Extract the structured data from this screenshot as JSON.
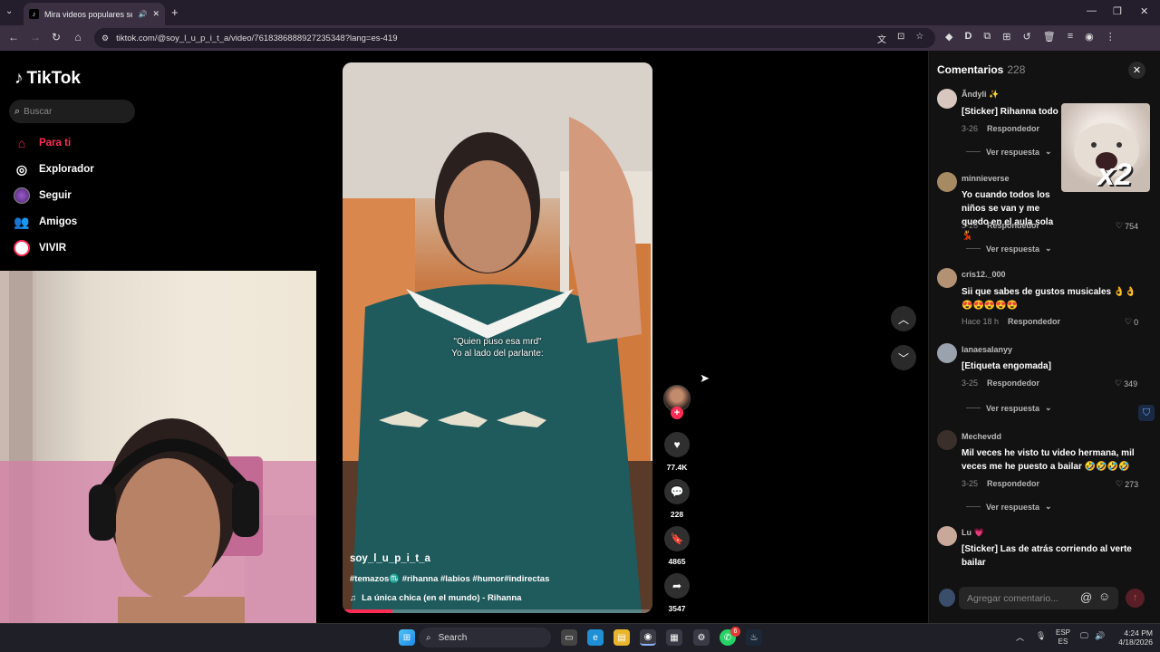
{
  "browser": {
    "tab_title": "Mira videos populares selec",
    "url": "tiktok.com/@soy_l_u_p_i_t_a/video/7618386888927235348?lang=es-419",
    "new_tab": "+",
    "minimize": "—",
    "restore": "❐",
    "close": "✕",
    "profile_letter": "D"
  },
  "tiktok": {
    "logo": "TikTok",
    "search_placeholder": "Buscar",
    "nav": [
      {
        "label": "Para ti",
        "active": true
      },
      {
        "label": "Explorador"
      },
      {
        "label": "Seguir"
      },
      {
        "label": "Amigos"
      },
      {
        "label": "VIVIR"
      }
    ]
  },
  "video": {
    "caption_line1": "\"Quien puso esa mrd\"",
    "caption_line2": "Yo al lado del parlante:",
    "username": "soy_l_u_p_i_t_a",
    "tags": "#temazos♏ #rihanna #labios #humor#indirectas",
    "music": "La única chica (en el mundo) - Rihanna",
    "progress": 0.16
  },
  "actions": {
    "likes": "77.4K",
    "comments": "228",
    "saves": "4865",
    "shares": "3547"
  },
  "comments_panel": {
    "title": "Comentarios",
    "count": "228",
    "sticker_text": "x2",
    "input_placeholder": "Agregar comentario...",
    "items": [
      {
        "user": "Ãndyli ✨",
        "text": "[Sticker] Rihanna todo c",
        "date": "3-26",
        "reply": "Respondedor",
        "likes": "",
        "view_replies": "Ver respuesta"
      },
      {
        "user": "minnieverse",
        "text": "Yo cuando todos los niños se van y me quedo en el aula sola 💃",
        "date": "3-26",
        "reply": "Respondedor",
        "likes": "754",
        "view_replies": "Ver respuesta"
      },
      {
        "user": "cris12._000",
        "text": "Sii que sabes de gustos musicales 👌👌 😍😍😍😍😍",
        "date": "Hace 18 h",
        "reply": "Respondedor",
        "likes": "0",
        "view_replies": ""
      },
      {
        "user": "lanaesalanyy",
        "text": "[Etiqueta engomada]",
        "date": "3-25",
        "reply": "Respondedor",
        "likes": "349",
        "view_replies": "Ver respuesta"
      },
      {
        "user": "Mechevdd",
        "text": "Mil veces he visto tu video hermana, mil veces me he puesto a bailar 🤣🤣🤣🤣",
        "date": "3-25",
        "reply": "Respondedor",
        "likes": "273",
        "view_replies": "Ver respuesta"
      },
      {
        "user": "Lu 💗",
        "text": "[Sticker] Las de atrás corriendo al verte bailar",
        "date": "",
        "reply": "",
        "likes": "",
        "view_replies": ""
      }
    ]
  },
  "taskbar": {
    "search": "Search",
    "lang1": "ESP",
    "lang2": "ES",
    "time": "4:24 PM",
    "date": "4/18/2026",
    "whatsapp_badge": "6"
  }
}
